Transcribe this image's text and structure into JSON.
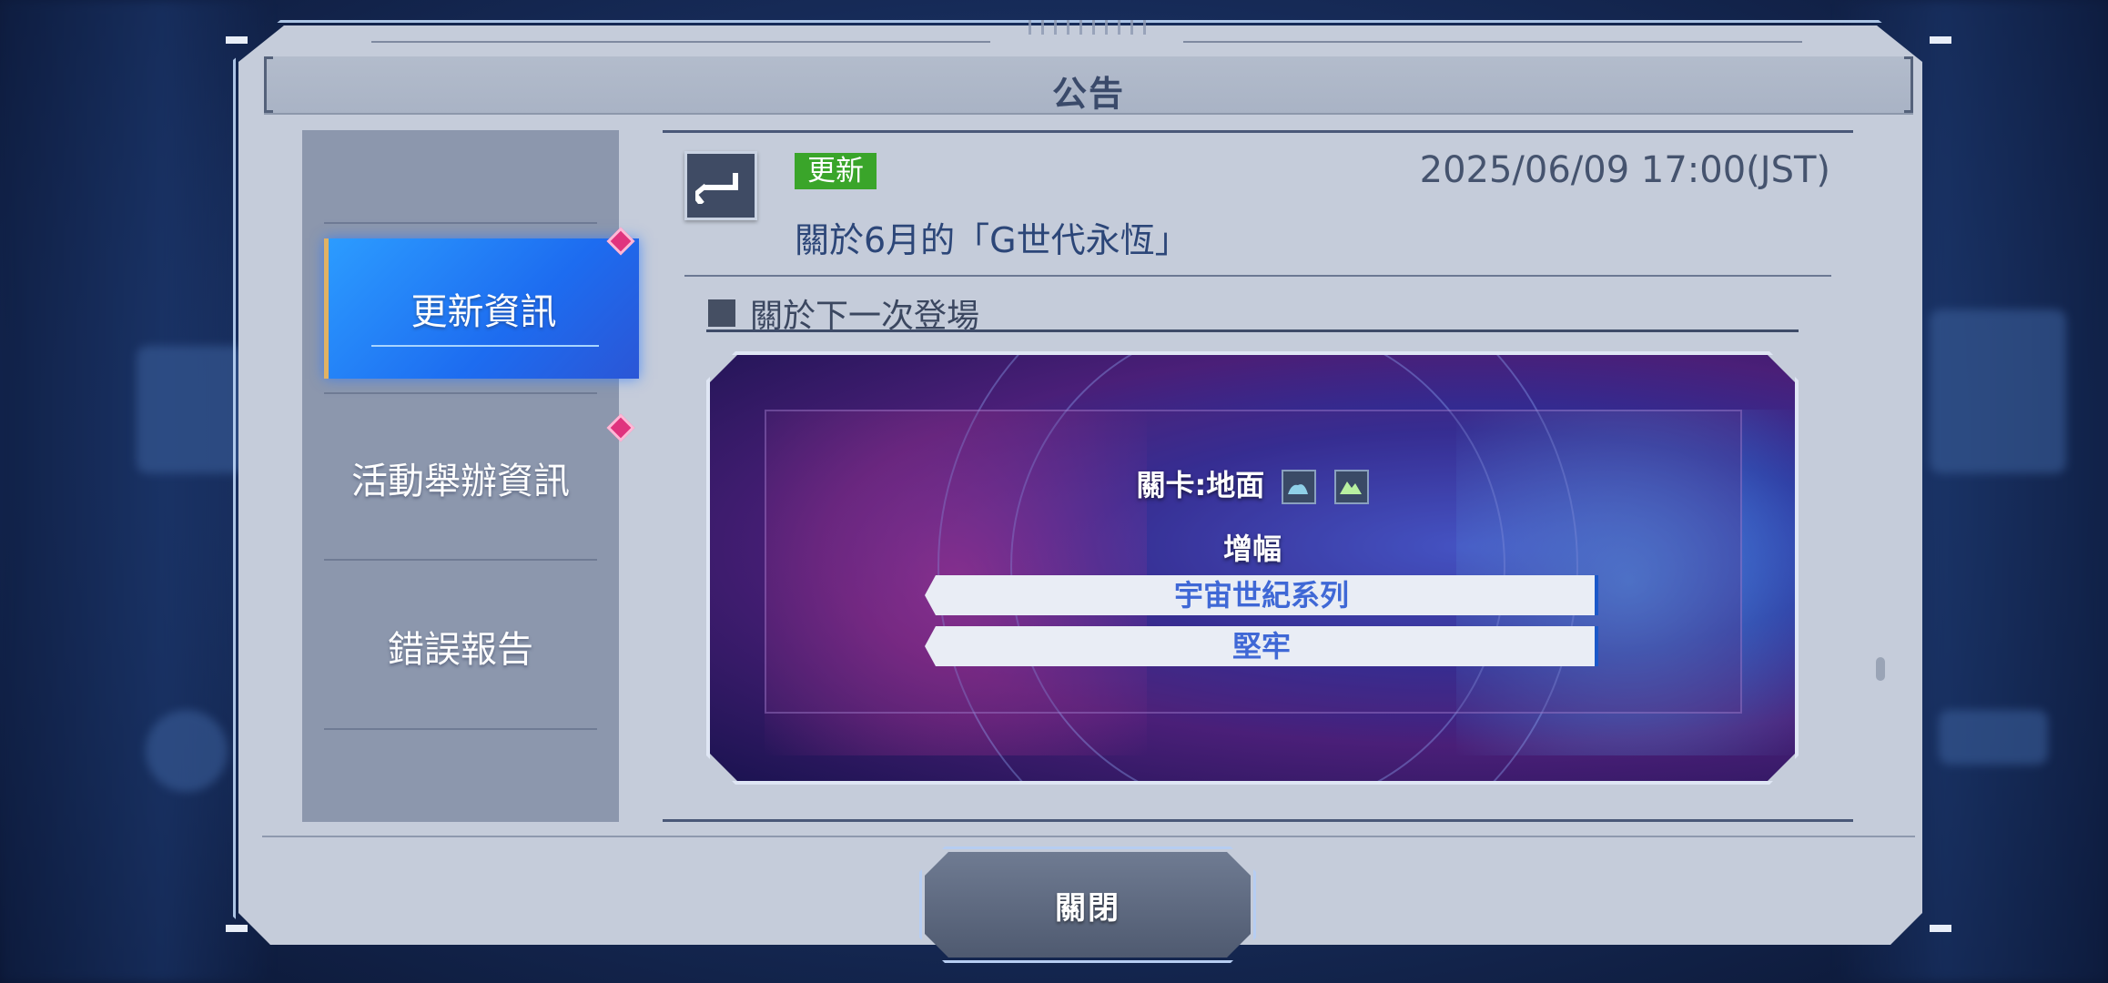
{
  "dialog": {
    "title": "公告"
  },
  "sidebar": {
    "items": [
      {
        "label": "更新資訊",
        "active": true,
        "has_badge": true
      },
      {
        "label": "活動舉辦資訊",
        "active": false,
        "has_badge": true
      },
      {
        "label": "錯誤報告",
        "active": false,
        "has_badge": false
      }
    ]
  },
  "notice": {
    "tag": "更新",
    "date": "2025/06/09 17:00(JST)",
    "title": "關於6月的「G世代永恆」",
    "section_heading": "關於下一次登場"
  },
  "banner": {
    "stage_label": "關卡:地面",
    "terrain_icons": [
      "ground-terrain-icon",
      "mountain-terrain-icon"
    ],
    "boost_label": "增幅",
    "boost_items": [
      "宇宙世紀系列",
      "堅牢"
    ]
  },
  "footer": {
    "close_label": "關閉"
  },
  "colors": {
    "active_tab": "#1d6cf0",
    "tag_green": "#3aa52a",
    "badge_pink": "#e0337e",
    "boost_text": "#3f68d6"
  }
}
